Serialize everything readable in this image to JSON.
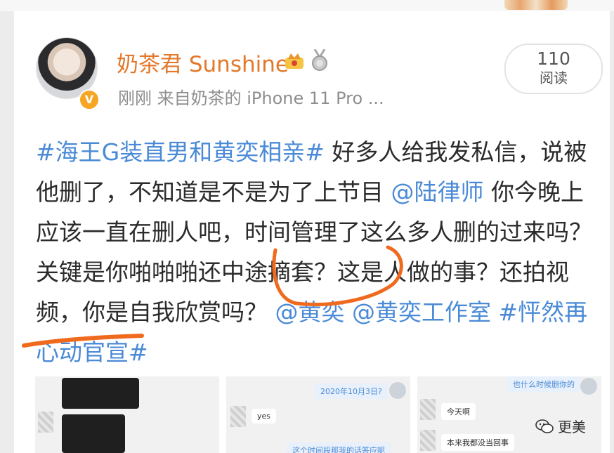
{
  "author": {
    "name": "奶茶君 Sunshine",
    "time": "刚刚",
    "source": "来自奶茶的 iPhone 11 Pro ..."
  },
  "reads": {
    "count": "110",
    "label": "阅读"
  },
  "post": {
    "tag1": "#海王G装直男和黄奕相亲#",
    "text1": " 好多人给我发私信，说被他删了，不知道是不是为了上节目 ",
    "mention1": "@陆律师",
    "text2": " 你今晚上应该一直在删人吧，时间管理了这么多人删的过来吗？关键是你啪啪啪还中途摘套？这是人做的事？还拍视频，你是自我欣赏吗？",
    "mention2": "@黄奕",
    "mention3": "@黄奕工作室",
    "tag2": "#怦然再心动官宣#"
  },
  "screenshots": {
    "shot2_date": "2020年10月3日?",
    "shot2_reply": "yes",
    "shot2_bottom": "这个时间段那我的话答应呢",
    "shot3_top": "也什么时候删你的",
    "shot3_msg1": "今天啊",
    "shot3_msg2": "本来我都没当回事"
  },
  "watermark": {
    "label": "更美"
  },
  "colors": {
    "name": "#e3782a",
    "link": "#4a8ad6",
    "mark": "#f06a1e"
  }
}
